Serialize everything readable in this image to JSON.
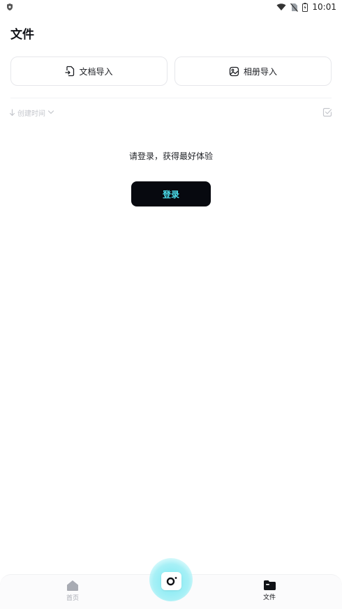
{
  "status_bar": {
    "time": "10:01",
    "icons": [
      "shield-icon",
      "wifi-icon",
      "no-sim-icon",
      "battery-icon"
    ]
  },
  "page": {
    "title": "文件"
  },
  "import_buttons": {
    "document": {
      "label": "文档导入",
      "icon": "document-import-icon"
    },
    "album": {
      "label": "相册导入",
      "icon": "album-import-icon"
    }
  },
  "sort": {
    "label": "创建时间",
    "icons": [
      "arrow-down-icon",
      "chevron-down-icon",
      "select-check-icon"
    ]
  },
  "login": {
    "prompt": "请登录，获得最好体验",
    "button_label": "登录"
  },
  "bottom_nav": {
    "home": {
      "label": "首页",
      "icon": "home-icon"
    },
    "files": {
      "label": "文件",
      "icon": "folder-icon"
    },
    "camera": {
      "icon": "camera-icon"
    }
  },
  "colors": {
    "primary_dark": "#07090f",
    "accent_cyan": "#4de0ee",
    "inactive": "#a8abb3",
    "border": "#e6e7eb"
  }
}
